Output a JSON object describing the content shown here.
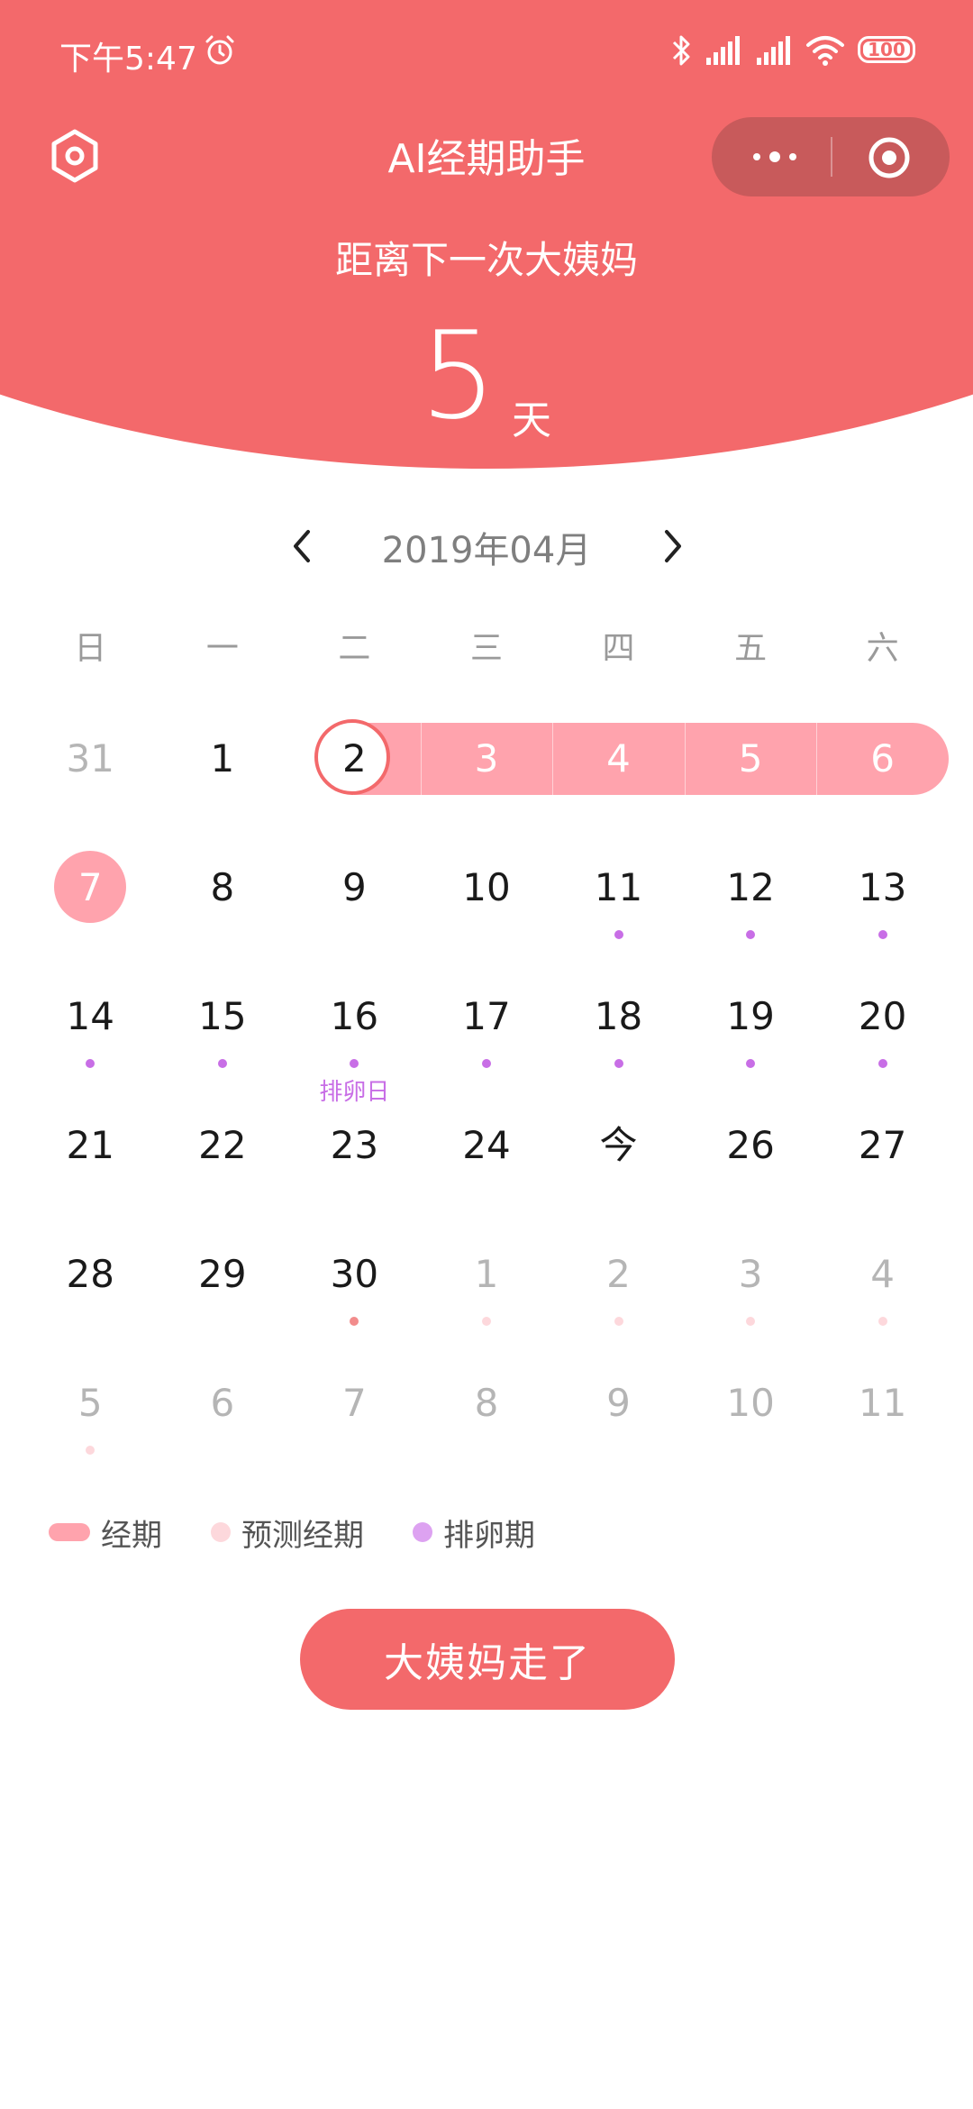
{
  "status_bar": {
    "time": "下午5:47",
    "battery": "100"
  },
  "nav": {
    "title": "AI经期助手"
  },
  "countdown": {
    "label": "距离下一次大姨妈",
    "days": "5",
    "unit": "天"
  },
  "calendar": {
    "month_label": "2019年04月",
    "weekdays": [
      "日",
      "一",
      "二",
      "三",
      "四",
      "五",
      "六"
    ],
    "weeks": [
      [
        {
          "label": "31",
          "other": true
        },
        {
          "label": "1"
        },
        {
          "label": "2",
          "mark": "period-start"
        },
        {
          "label": "3",
          "mark": "period"
        },
        {
          "label": "4",
          "mark": "period"
        },
        {
          "label": "5",
          "mark": "period"
        },
        {
          "label": "6",
          "mark": "period"
        }
      ],
      [
        {
          "label": "7",
          "mark": "period-filled"
        },
        {
          "label": "8"
        },
        {
          "label": "9"
        },
        {
          "label": "10"
        },
        {
          "label": "11",
          "dot": "ovu"
        },
        {
          "label": "12",
          "dot": "ovu"
        },
        {
          "label": "13",
          "dot": "ovu"
        }
      ],
      [
        {
          "label": "14",
          "dot": "ovu"
        },
        {
          "label": "15",
          "dot": "ovu"
        },
        {
          "label": "16",
          "dot": "ovu",
          "note": "排卵日"
        },
        {
          "label": "17",
          "dot": "ovu"
        },
        {
          "label": "18",
          "dot": "ovu"
        },
        {
          "label": "19",
          "dot": "ovu"
        },
        {
          "label": "20",
          "dot": "ovu"
        }
      ],
      [
        {
          "label": "21"
        },
        {
          "label": "22"
        },
        {
          "label": "23"
        },
        {
          "label": "24"
        },
        {
          "label": "今"
        },
        {
          "label": "26"
        },
        {
          "label": "27"
        }
      ],
      [
        {
          "label": "28"
        },
        {
          "label": "29"
        },
        {
          "label": "30",
          "dot": "period"
        },
        {
          "label": "1",
          "other": true,
          "dot": "pred"
        },
        {
          "label": "2",
          "other": true,
          "dot": "pred"
        },
        {
          "label": "3",
          "other": true,
          "dot": "pred"
        },
        {
          "label": "4",
          "other": true,
          "dot": "pred"
        }
      ],
      [
        {
          "label": "5",
          "other": true,
          "dot": "pred"
        },
        {
          "label": "6",
          "other": true
        },
        {
          "label": "7",
          "other": true
        },
        {
          "label": "8",
          "other": true
        },
        {
          "label": "9",
          "other": true
        },
        {
          "label": "10",
          "other": true
        },
        {
          "label": "11",
          "other": true
        }
      ]
    ]
  },
  "legend": {
    "period": "经期",
    "predicted": "预测经期",
    "ovulation": "排卵期"
  },
  "button": {
    "label": "大姨妈走了"
  },
  "colors": {
    "header": "#f3696b",
    "period": "#ffa3ad",
    "predicted": "#fdd8dc",
    "ovulation": "#c86ee6",
    "capsule": "#c85a5b"
  }
}
